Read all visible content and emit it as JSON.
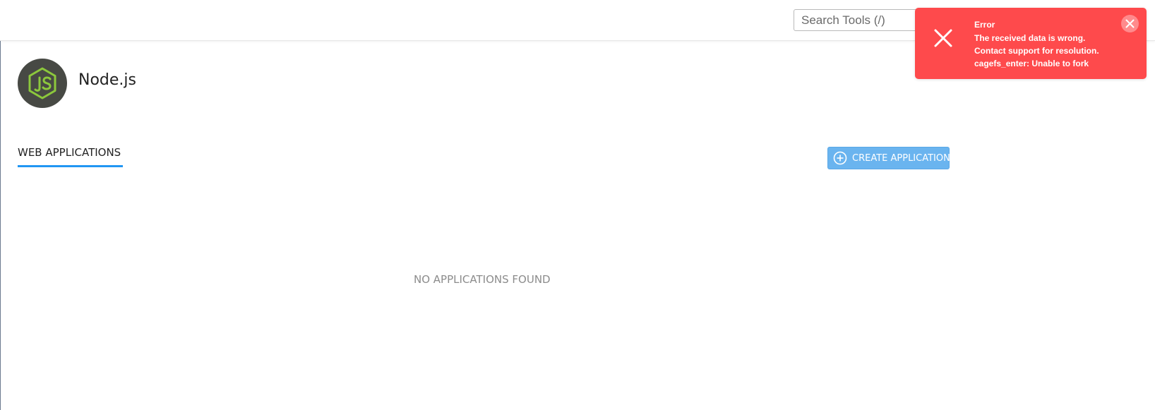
{
  "search": {
    "placeholder": "Search Tools (/)"
  },
  "app": {
    "logo_icon": "nodejs-logo-icon",
    "title": "Node.js"
  },
  "tabs": [
    {
      "label": "WEB APPLICATIONS",
      "active": true
    }
  ],
  "actions": {
    "create_label": "CREATE APPLICATION",
    "create_icon": "plus-circle-icon"
  },
  "empty_state": {
    "message": "NO APPLICATIONS FOUND"
  },
  "toast": {
    "type": "error",
    "icon": "x-icon",
    "close_icon": "close-icon",
    "title": "Error",
    "message": "The received data is wrong. Contact support for resolution. cagefs_enter: Unable to fork"
  },
  "colors": {
    "accent": "#2196f3",
    "create_button": "#6ab4ef",
    "toast_background": "#fe4a4c",
    "logo_background": "#474944",
    "logo_green": "#8cc83c"
  }
}
